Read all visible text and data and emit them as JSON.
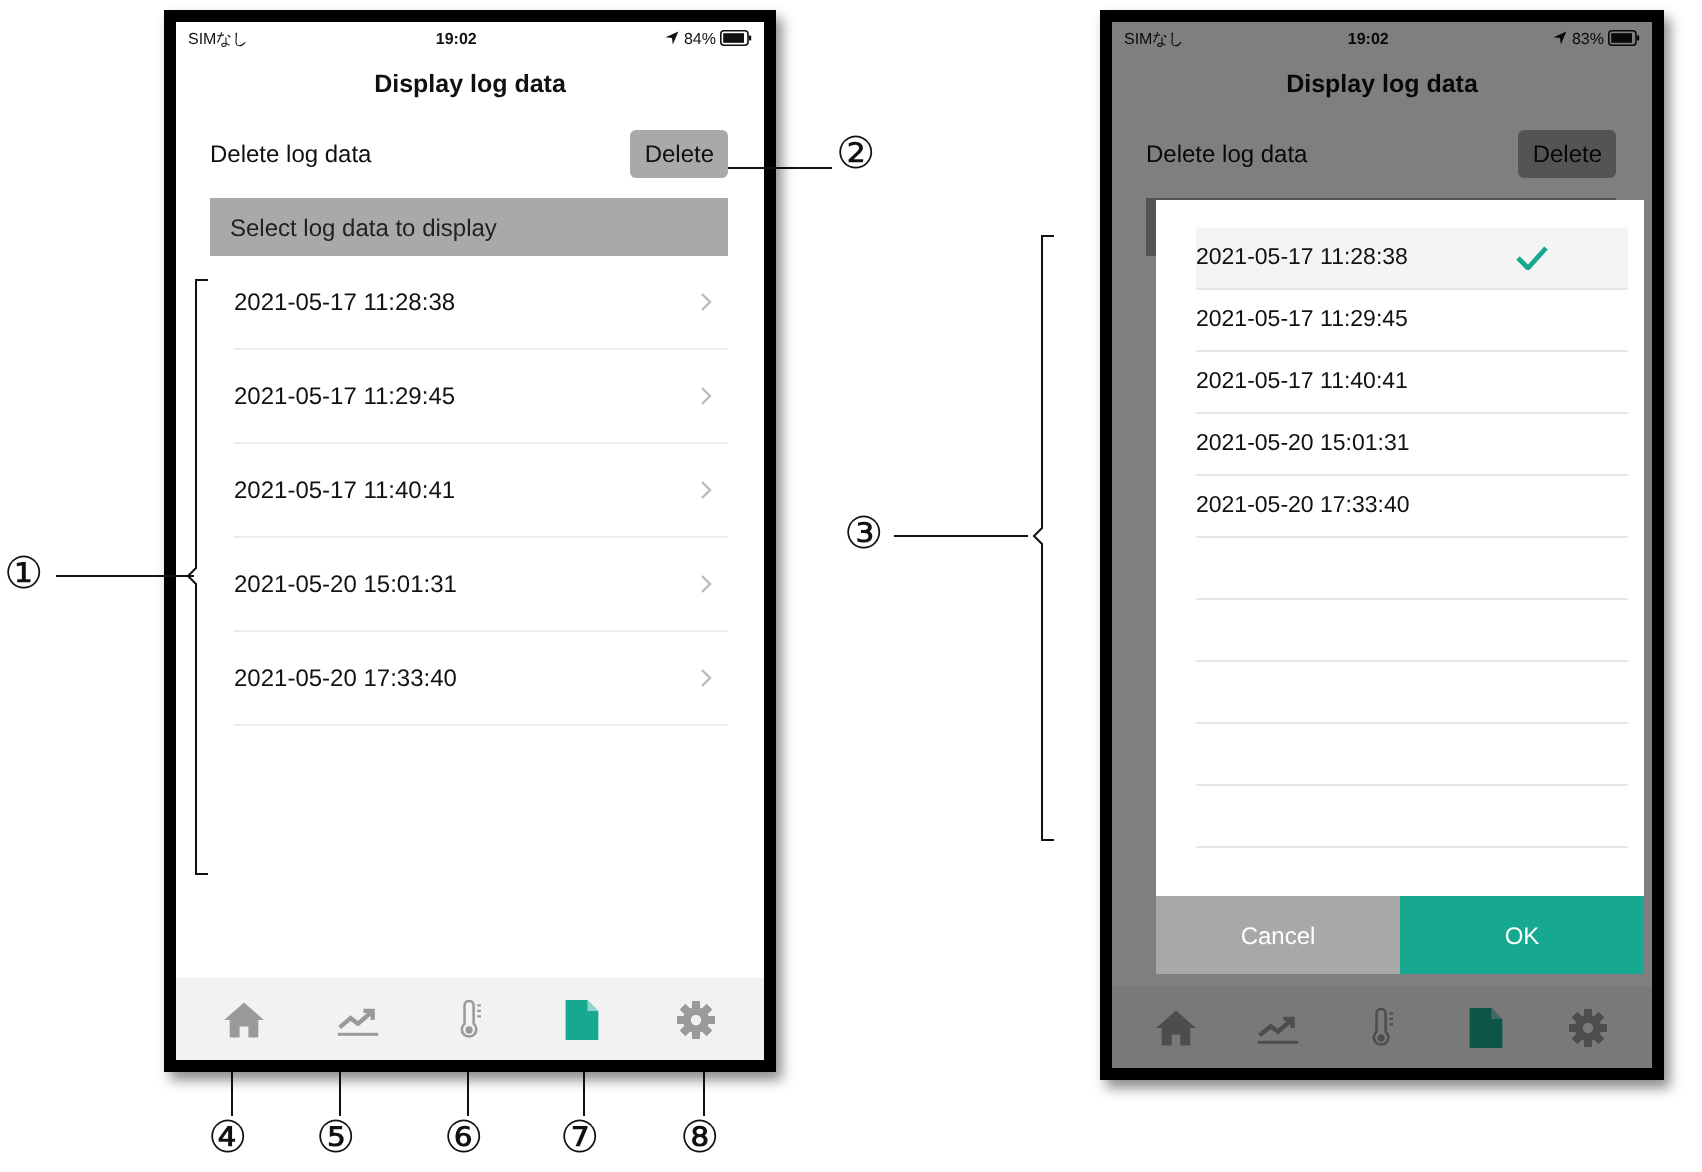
{
  "screens": [
    {
      "status_bar": {
        "carrier": "SIMなし",
        "time": "19:02",
        "battery": "84%"
      },
      "title": "Display log data",
      "dimmed": false,
      "delete_label": "Delete log data",
      "delete_button": "Delete",
      "list_header": "Select log data to display",
      "entries": [
        "2021-05-17 11:28:38",
        "2021-05-17 11:29:45",
        "2021-05-17 11:40:41",
        "2021-05-20 15:01:31",
        "2021-05-20 17:33:40"
      ],
      "tabs": [
        {
          "kind": "home",
          "selected": false
        },
        {
          "kind": "chart",
          "selected": false
        },
        {
          "kind": "thermometer",
          "selected": false
        },
        {
          "kind": "document",
          "selected": true
        },
        {
          "kind": "settings",
          "selected": false
        }
      ]
    },
    {
      "status_bar": {
        "carrier": "SIMなし",
        "time": "19:02",
        "battery": "83%"
      },
      "title": "Display log data",
      "dimmed": true,
      "delete_label": "Delete log data",
      "delete_button": "Delete",
      "picker": {
        "options": [
          {
            "label": "2021-05-17 11:28:38",
            "selected": true
          },
          {
            "label": "2021-05-17 11:29:45",
            "selected": false
          },
          {
            "label": "2021-05-17 11:40:41",
            "selected": false
          },
          {
            "label": "2021-05-20 15:01:31",
            "selected": false
          },
          {
            "label": "2021-05-20 17:33:40",
            "selected": false
          }
        ],
        "cancel": "Cancel",
        "ok": "OK"
      },
      "tabs": [
        {
          "kind": "home",
          "selected": false
        },
        {
          "kind": "chart",
          "selected": false
        },
        {
          "kind": "thermometer",
          "selected": false
        },
        {
          "kind": "document",
          "selected": true
        },
        {
          "kind": "settings",
          "selected": false
        }
      ]
    }
  ],
  "callouts": [
    "①",
    "②",
    "③",
    "④",
    "⑤",
    "⑥",
    "⑦",
    "⑧"
  ]
}
